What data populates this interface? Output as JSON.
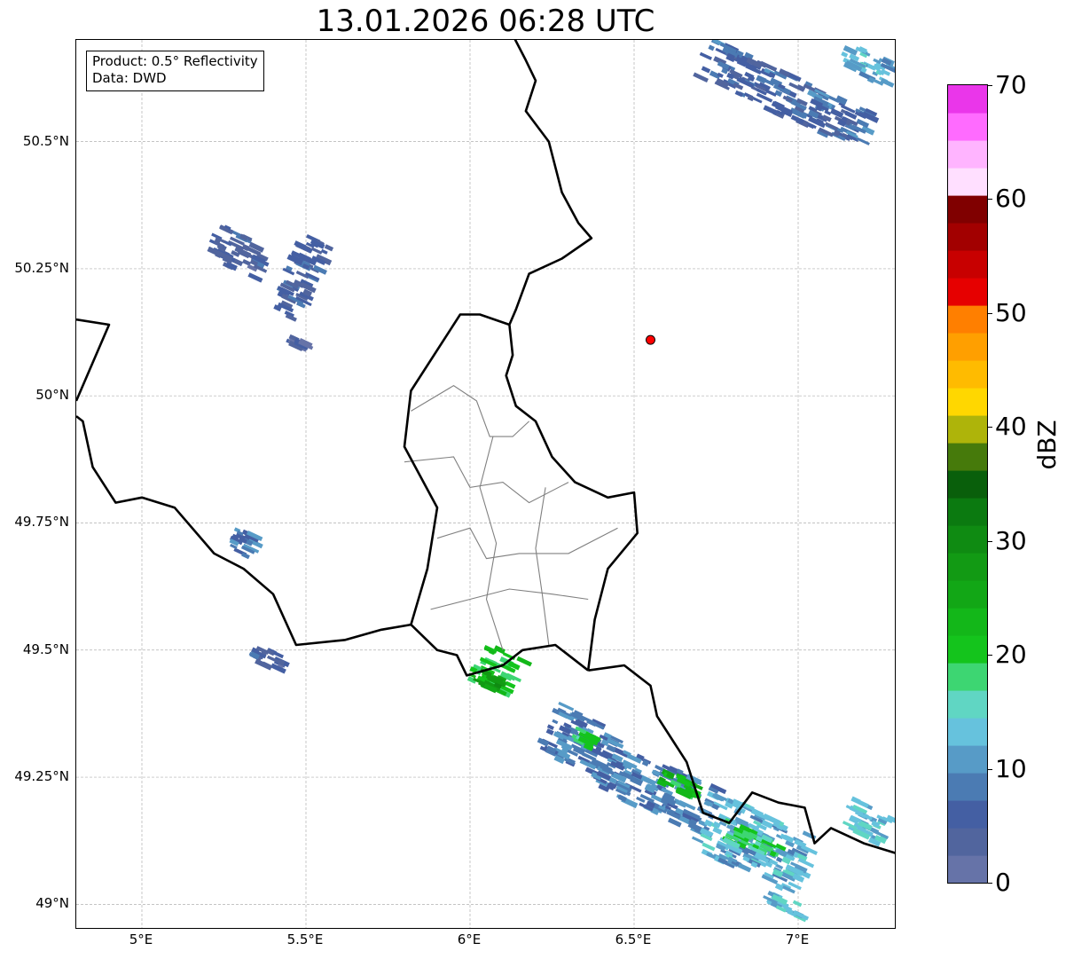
{
  "title": "13.01.2026 06:28 UTC",
  "infobox": {
    "product": "Product: 0.5° Reflectivity",
    "data": "Data: DWD"
  },
  "map": {
    "lon_range": [
      4.8,
      7.3
    ],
    "lat_range": [
      48.95,
      50.7
    ],
    "lat_ticks": [
      {
        "value": 49.0,
        "label": "49°N"
      },
      {
        "value": 49.25,
        "label": "49.25°N"
      },
      {
        "value": 49.5,
        "label": "49.5°N"
      },
      {
        "value": 49.75,
        "label": "49.75°N"
      },
      {
        "value": 50.0,
        "label": "50°N"
      },
      {
        "value": 50.25,
        "label": "50.25°N"
      },
      {
        "value": 50.5,
        "label": "50.5°N"
      }
    ],
    "lon_ticks": [
      {
        "value": 5.0,
        "label": "5°E"
      },
      {
        "value": 5.5,
        "label": "5.5°E"
      },
      {
        "value": 6.0,
        "label": "6°E"
      },
      {
        "value": 6.5,
        "label": "6.5°E"
      },
      {
        "value": 7.0,
        "label": "7°E"
      }
    ],
    "radar_site": {
      "lon": 6.55,
      "lat": 50.11,
      "color": "#ff0000"
    },
    "grid_color": "#b0b0b0",
    "border_color": "#000000",
    "district_color": "#808080"
  },
  "colorbar": {
    "label": "dBZ",
    "min": 0,
    "max": 70,
    "ticks": [
      0,
      10,
      20,
      30,
      40,
      50,
      60,
      70
    ],
    "colors": [
      "#6673a8",
      "#51659e",
      "#445fa3",
      "#4b7bb3",
      "#579bc7",
      "#66c2dd",
      "#60d6c3",
      "#3dd672",
      "#14c41c",
      "#13b719",
      "#12a716",
      "#129a14",
      "#0f8b12",
      "#0b7a10",
      "#095f0b",
      "#467a0b",
      "#aeb40a",
      "#ffd700",
      "#ffbb00",
      "#ff9f00",
      "#ff7f00",
      "#e60000",
      "#c80000",
      "#a20000",
      "#800000",
      "#ffdfff",
      "#ffb4ff",
      "#ff6bff",
      "#ea36ea"
    ]
  },
  "echoes": [
    {
      "lon": 5.28,
      "lat": 50.29,
      "dlon": 0.16,
      "dlat": 0.07,
      "dbz": 5
    },
    {
      "lon": 5.47,
      "lat": 50.24,
      "dlon": 0.09,
      "dlat": 0.16,
      "dbz": 6
    },
    {
      "lon": 5.46,
      "lat": 50.11,
      "dlon": 0.04,
      "dlat": 0.02,
      "dbz": 4
    },
    {
      "lon": 6.95,
      "lat": 50.6,
      "dlon": 0.55,
      "dlat": 0.08,
      "dbz": 7
    },
    {
      "lon": 7.2,
      "lat": 50.66,
      "dlon": 0.15,
      "dlat": 0.05,
      "dbz": 12
    },
    {
      "lon": 5.3,
      "lat": 49.72,
      "dlon": 0.06,
      "dlat": 0.05,
      "dbz": 8
    },
    {
      "lon": 5.38,
      "lat": 49.49,
      "dlon": 0.1,
      "dlat": 0.03,
      "dbz": 5
    },
    {
      "lon": 6.07,
      "lat": 49.47,
      "dlon": 0.12,
      "dlat": 0.08,
      "dbz": 20
    },
    {
      "lon": 6.05,
      "lat": 49.45,
      "dlon": 0.08,
      "dlat": 0.03,
      "dbz": 26
    },
    {
      "lon": 6.32,
      "lat": 49.33,
      "dlon": 0.2,
      "dlat": 0.1,
      "dbz": 8
    },
    {
      "lon": 6.35,
      "lat": 49.33,
      "dlon": 0.08,
      "dlat": 0.03,
      "dbz": 18
    },
    {
      "lon": 6.55,
      "lat": 49.24,
      "dlon": 0.35,
      "dlat": 0.1,
      "dbz": 9
    },
    {
      "lon": 6.63,
      "lat": 49.24,
      "dlon": 0.12,
      "dlat": 0.04,
      "dbz": 22
    },
    {
      "lon": 6.85,
      "lat": 49.13,
      "dlon": 0.35,
      "dlat": 0.12,
      "dbz": 12
    },
    {
      "lon": 6.85,
      "lat": 49.13,
      "dlon": 0.18,
      "dlat": 0.04,
      "dbz": 19
    },
    {
      "lon": 7.2,
      "lat": 49.17,
      "dlon": 0.14,
      "dlat": 0.06,
      "dbz": 13
    },
    {
      "lon": 6.95,
      "lat": 49.01,
      "dlon": 0.12,
      "dlat": 0.03,
      "dbz": 14
    }
  ]
}
